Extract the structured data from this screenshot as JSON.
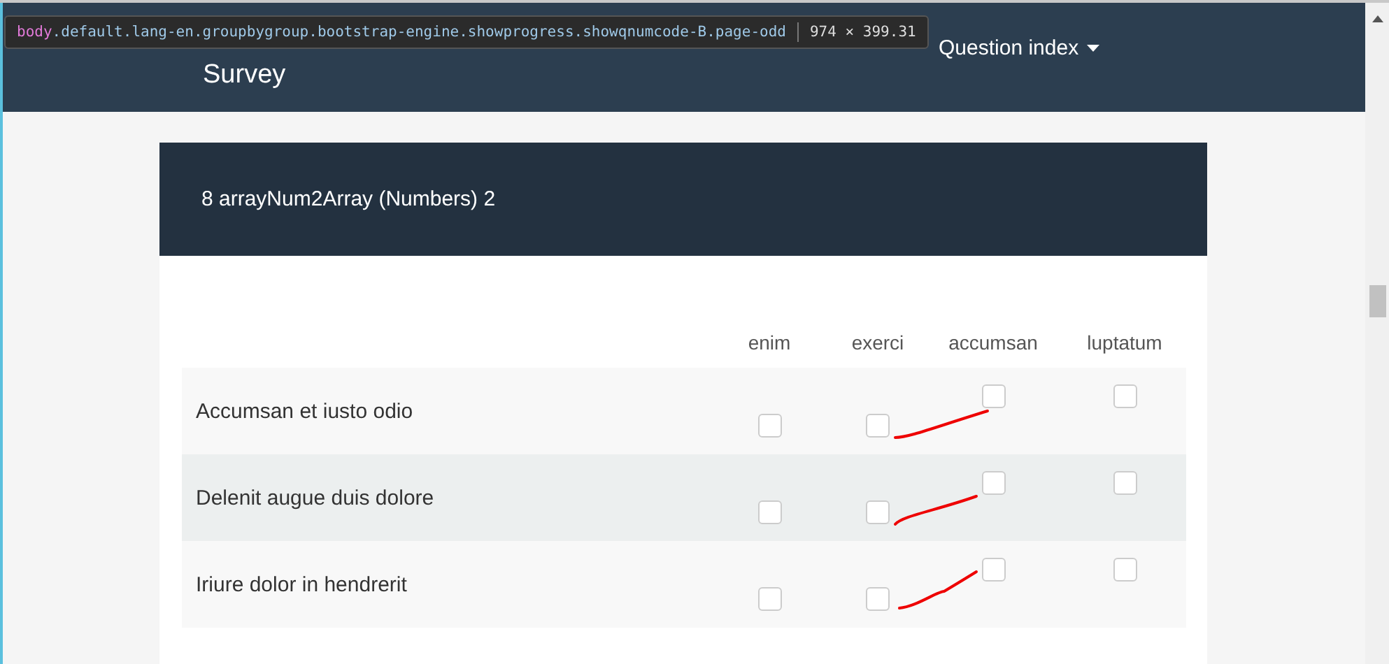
{
  "header": {
    "title": "Survey",
    "links": [
      {
        "label": "Question index",
        "dropdown": true
      }
    ]
  },
  "inspector_tooltip": {
    "tag": "body",
    "classes": ".default.lang-en.groupbygroup.bootstrap-engine.showprogress.showqnumcode-B.page-odd",
    "size": "974 × 399.31"
  },
  "question": {
    "title": "8 arrayNum2Array (Numbers) 2",
    "columns": [
      "enim",
      "exerci",
      "accumsan",
      "luptatum"
    ],
    "rows": [
      {
        "label": "Accumsan et iusto odio",
        "checked": [
          false,
          false,
          false,
          false
        ]
      },
      {
        "label": "Delenit augue duis dolore",
        "checked": [
          false,
          false,
          false,
          false
        ]
      },
      {
        "label": "Iriure dolor in hendrerit",
        "checked": [
          false,
          false,
          false,
          false
        ]
      }
    ]
  }
}
